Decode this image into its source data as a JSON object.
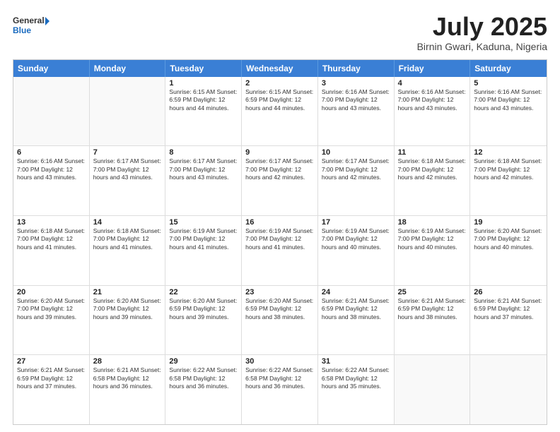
{
  "logo": {
    "general": "General",
    "blue": "Blue"
  },
  "title": "July 2025",
  "location": "Birnin Gwari, Kaduna, Nigeria",
  "days_of_week": [
    "Sunday",
    "Monday",
    "Tuesday",
    "Wednesday",
    "Thursday",
    "Friday",
    "Saturday"
  ],
  "weeks": [
    [
      {
        "day": "",
        "info": ""
      },
      {
        "day": "",
        "info": ""
      },
      {
        "day": "1",
        "info": "Sunrise: 6:15 AM\nSunset: 6:59 PM\nDaylight: 12 hours and 44 minutes."
      },
      {
        "day": "2",
        "info": "Sunrise: 6:15 AM\nSunset: 6:59 PM\nDaylight: 12 hours and 44 minutes."
      },
      {
        "day": "3",
        "info": "Sunrise: 6:16 AM\nSunset: 7:00 PM\nDaylight: 12 hours and 43 minutes."
      },
      {
        "day": "4",
        "info": "Sunrise: 6:16 AM\nSunset: 7:00 PM\nDaylight: 12 hours and 43 minutes."
      },
      {
        "day": "5",
        "info": "Sunrise: 6:16 AM\nSunset: 7:00 PM\nDaylight: 12 hours and 43 minutes."
      }
    ],
    [
      {
        "day": "6",
        "info": "Sunrise: 6:16 AM\nSunset: 7:00 PM\nDaylight: 12 hours and 43 minutes."
      },
      {
        "day": "7",
        "info": "Sunrise: 6:17 AM\nSunset: 7:00 PM\nDaylight: 12 hours and 43 minutes."
      },
      {
        "day": "8",
        "info": "Sunrise: 6:17 AM\nSunset: 7:00 PM\nDaylight: 12 hours and 43 minutes."
      },
      {
        "day": "9",
        "info": "Sunrise: 6:17 AM\nSunset: 7:00 PM\nDaylight: 12 hours and 42 minutes."
      },
      {
        "day": "10",
        "info": "Sunrise: 6:17 AM\nSunset: 7:00 PM\nDaylight: 12 hours and 42 minutes."
      },
      {
        "day": "11",
        "info": "Sunrise: 6:18 AM\nSunset: 7:00 PM\nDaylight: 12 hours and 42 minutes."
      },
      {
        "day": "12",
        "info": "Sunrise: 6:18 AM\nSunset: 7:00 PM\nDaylight: 12 hours and 42 minutes."
      }
    ],
    [
      {
        "day": "13",
        "info": "Sunrise: 6:18 AM\nSunset: 7:00 PM\nDaylight: 12 hours and 41 minutes."
      },
      {
        "day": "14",
        "info": "Sunrise: 6:18 AM\nSunset: 7:00 PM\nDaylight: 12 hours and 41 minutes."
      },
      {
        "day": "15",
        "info": "Sunrise: 6:19 AM\nSunset: 7:00 PM\nDaylight: 12 hours and 41 minutes."
      },
      {
        "day": "16",
        "info": "Sunrise: 6:19 AM\nSunset: 7:00 PM\nDaylight: 12 hours and 41 minutes."
      },
      {
        "day": "17",
        "info": "Sunrise: 6:19 AM\nSunset: 7:00 PM\nDaylight: 12 hours and 40 minutes."
      },
      {
        "day": "18",
        "info": "Sunrise: 6:19 AM\nSunset: 7:00 PM\nDaylight: 12 hours and 40 minutes."
      },
      {
        "day": "19",
        "info": "Sunrise: 6:20 AM\nSunset: 7:00 PM\nDaylight: 12 hours and 40 minutes."
      }
    ],
    [
      {
        "day": "20",
        "info": "Sunrise: 6:20 AM\nSunset: 7:00 PM\nDaylight: 12 hours and 39 minutes."
      },
      {
        "day": "21",
        "info": "Sunrise: 6:20 AM\nSunset: 7:00 PM\nDaylight: 12 hours and 39 minutes."
      },
      {
        "day": "22",
        "info": "Sunrise: 6:20 AM\nSunset: 6:59 PM\nDaylight: 12 hours and 39 minutes."
      },
      {
        "day": "23",
        "info": "Sunrise: 6:20 AM\nSunset: 6:59 PM\nDaylight: 12 hours and 38 minutes."
      },
      {
        "day": "24",
        "info": "Sunrise: 6:21 AM\nSunset: 6:59 PM\nDaylight: 12 hours and 38 minutes."
      },
      {
        "day": "25",
        "info": "Sunrise: 6:21 AM\nSunset: 6:59 PM\nDaylight: 12 hours and 38 minutes."
      },
      {
        "day": "26",
        "info": "Sunrise: 6:21 AM\nSunset: 6:59 PM\nDaylight: 12 hours and 37 minutes."
      }
    ],
    [
      {
        "day": "27",
        "info": "Sunrise: 6:21 AM\nSunset: 6:59 PM\nDaylight: 12 hours and 37 minutes."
      },
      {
        "day": "28",
        "info": "Sunrise: 6:21 AM\nSunset: 6:58 PM\nDaylight: 12 hours and 36 minutes."
      },
      {
        "day": "29",
        "info": "Sunrise: 6:22 AM\nSunset: 6:58 PM\nDaylight: 12 hours and 36 minutes."
      },
      {
        "day": "30",
        "info": "Sunrise: 6:22 AM\nSunset: 6:58 PM\nDaylight: 12 hours and 36 minutes."
      },
      {
        "day": "31",
        "info": "Sunrise: 6:22 AM\nSunset: 6:58 PM\nDaylight: 12 hours and 35 minutes."
      },
      {
        "day": "",
        "info": ""
      },
      {
        "day": "",
        "info": ""
      }
    ]
  ]
}
